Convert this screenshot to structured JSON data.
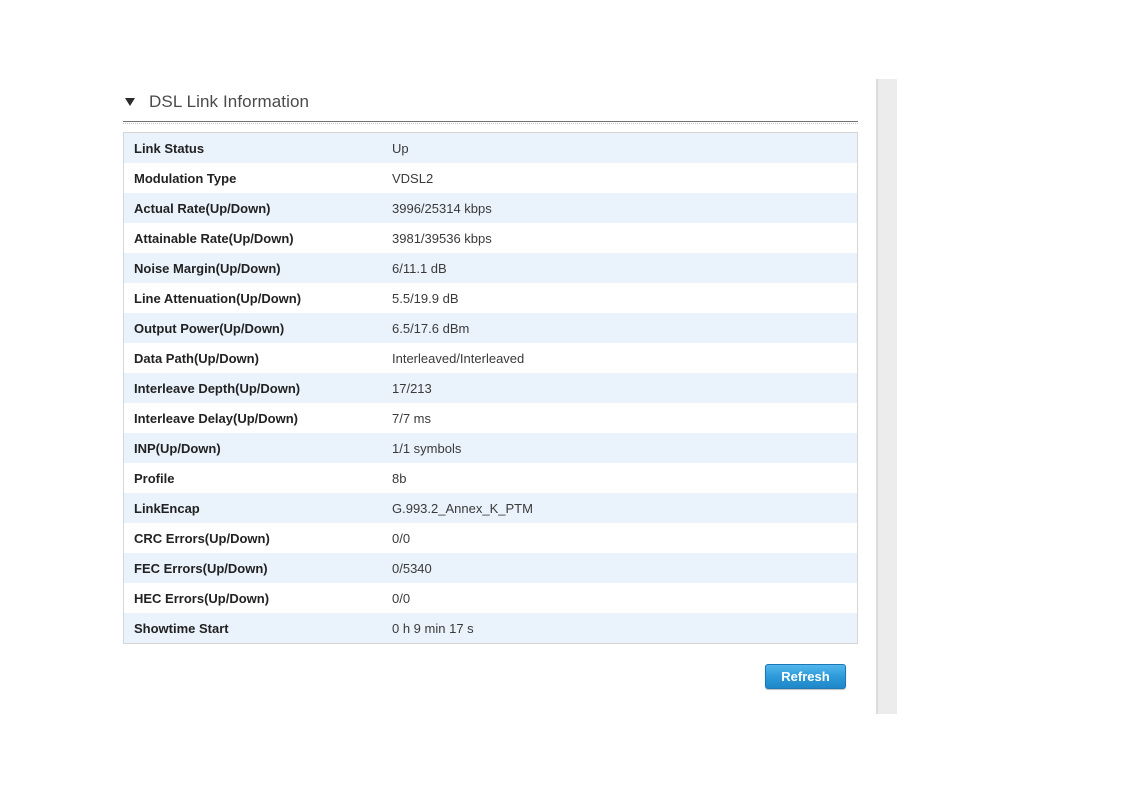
{
  "section": {
    "title": "DSL Link Information",
    "icon": "triangle-down-icon"
  },
  "rows": [
    {
      "label": "Link Status",
      "value": "Up"
    },
    {
      "label": "Modulation Type",
      "value": "VDSL2"
    },
    {
      "label": "Actual Rate(Up/Down)",
      "value": "3996/25314 kbps"
    },
    {
      "label": "Attainable Rate(Up/Down)",
      "value": "3981/39536 kbps"
    },
    {
      "label": "Noise Margin(Up/Down)",
      "value": "6/11.1 dB"
    },
    {
      "label": "Line Attenuation(Up/Down)",
      "value": "5.5/19.9 dB"
    },
    {
      "label": "Output Power(Up/Down)",
      "value": "6.5/17.6 dBm"
    },
    {
      "label": "Data Path(Up/Down)",
      "value": "Interleaved/Interleaved"
    },
    {
      "label": "Interleave Depth(Up/Down)",
      "value": "17/213"
    },
    {
      "label": "Interleave Delay(Up/Down)",
      "value": "7/7 ms"
    },
    {
      "label": "INP(Up/Down)",
      "value": "1/1 symbols"
    },
    {
      "label": "Profile",
      "value": "8b"
    },
    {
      "label": "LinkEncap",
      "value": "G.993.2_Annex_K_PTM"
    },
    {
      "label": "CRC Errors(Up/Down)",
      "value": "0/0"
    },
    {
      "label": "FEC Errors(Up/Down)",
      "value": "0/5340"
    },
    {
      "label": "HEC Errors(Up/Down)",
      "value": "0/0"
    },
    {
      "label": "Showtime Start",
      "value": "0 h 9 min 17 s"
    }
  ],
  "actions": {
    "refresh_label": "Refresh"
  },
  "colors": {
    "row_alt": "#eaf3fb",
    "button": "#2d9ad9"
  }
}
